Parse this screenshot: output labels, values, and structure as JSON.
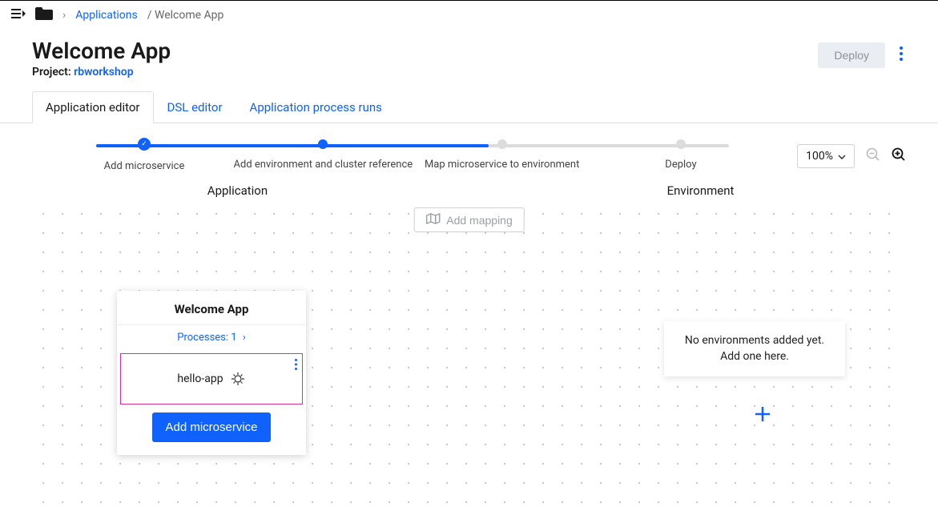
{
  "breadcrumb": {
    "root_link": "Applications",
    "current": "Welcome App"
  },
  "header": {
    "title": "Welcome App",
    "project_label": "Project:",
    "project_link": "rbworkshop",
    "deploy_label": "Deploy"
  },
  "tabs": [
    {
      "label": "Application editor",
      "active": true
    },
    {
      "label": "DSL editor",
      "active": false
    },
    {
      "label": "Application process runs",
      "active": false
    }
  ],
  "stepper": [
    {
      "label": "Add microservice",
      "state": "done"
    },
    {
      "label": "Add environment and cluster reference",
      "state": "active"
    },
    {
      "label": "Map microservice to environment",
      "state": "pending"
    },
    {
      "label": "Deploy",
      "state": "pending"
    }
  ],
  "zoom": {
    "value": "100%"
  },
  "canvas": {
    "section_application": "Application",
    "section_environment": "Environment",
    "add_mapping_label": "Add mapping",
    "app_card": {
      "title": "Welcome App",
      "processes_label": "Processes: 1",
      "microservice": {
        "name": "hello-app",
        "type_icon": "helm-icon"
      },
      "add_microservice_label": "Add microservice"
    },
    "env_empty": {
      "line1": "No environments added yet.",
      "line2": "Add one here."
    }
  }
}
